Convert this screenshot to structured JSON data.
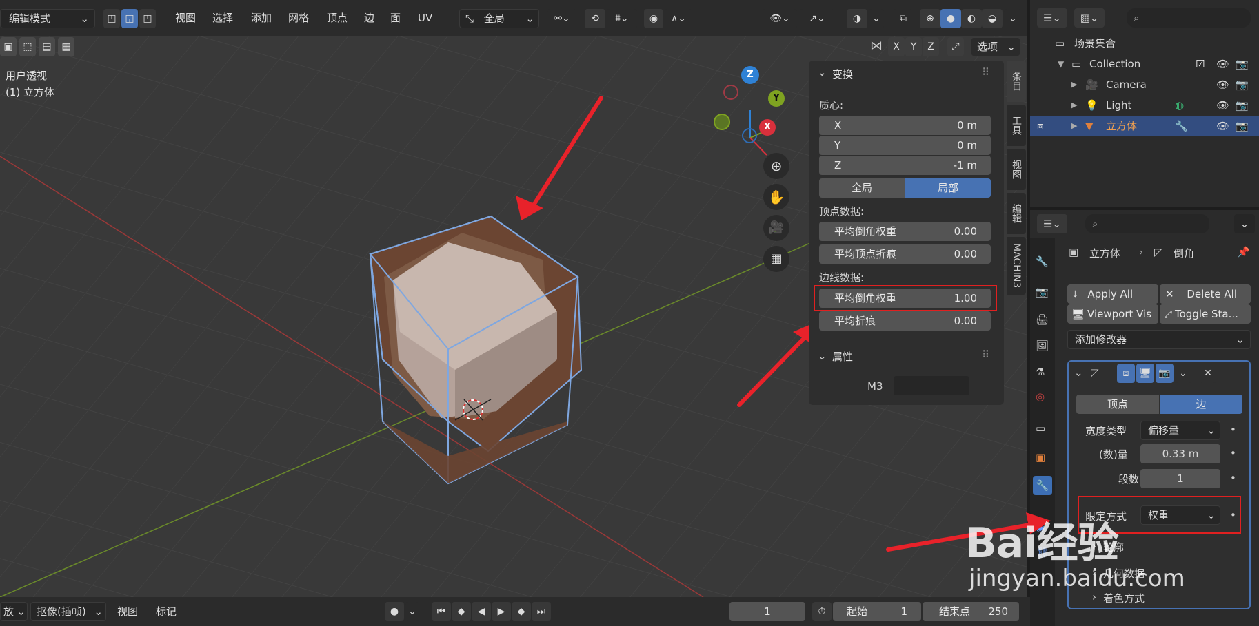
{
  "header": {
    "mode": "编辑模式",
    "menu": [
      "视图",
      "选择",
      "添加",
      "网格",
      "顶点",
      "边",
      "面",
      "UV"
    ],
    "orientation": "全局",
    "options_label": "选项",
    "axes": [
      "X",
      "Y",
      "Z"
    ]
  },
  "viewport": {
    "view_label": "用户透视",
    "object_label": "(1) 立方体",
    "gizmo": {
      "z": "Z",
      "y": "Y",
      "x": "X"
    }
  },
  "npanel": {
    "transform_title": "变换",
    "centroid_label": "质心:",
    "centroid": [
      {
        "axis": "X",
        "value": "0 m"
      },
      {
        "axis": "Y",
        "value": "0 m"
      },
      {
        "axis": "Z",
        "value": "-1 m"
      }
    ],
    "space_global": "全局",
    "space_local": "局部",
    "vertex_data_label": "顶点数据:",
    "vertex_data": [
      {
        "label": "平均倒角权重",
        "value": "0.00"
      },
      {
        "label": "平均顶点折痕",
        "value": "0.00"
      }
    ],
    "edge_data_label": "边线数据:",
    "edge_data": [
      {
        "label": "平均倒角权重",
        "value": "1.00"
      },
      {
        "label": "平均折痕",
        "value": "0.00"
      }
    ],
    "attributes_title": "属性",
    "attr_label": "M3",
    "tabs": [
      "条目",
      "工具",
      "视图",
      "编辑",
      "MACHIN3"
    ]
  },
  "outliner": {
    "scene_collection": "场景集合",
    "items": [
      {
        "name": "Collection",
        "type": "collection"
      },
      {
        "name": "Camera",
        "type": "camera"
      },
      {
        "name": "Light",
        "type": "light"
      },
      {
        "name": "立方体",
        "type": "mesh"
      }
    ]
  },
  "properties": {
    "breadcrumb_object": "立方体",
    "breadcrumb_modifier": "倒角",
    "apply_all": "Apply All",
    "delete_all": "Delete All",
    "viewport_vis": "Viewport Vis",
    "toggle_stack": "Toggle Sta...",
    "add_modifier": "添加修改器",
    "affect_vertex": "顶点",
    "affect_edge": "边",
    "width_type_label": "宽度类型",
    "width_type_value": "偏移量",
    "amount_label": "(数)量",
    "amount_value": "0.33 m",
    "segments_label": "段数",
    "segments_value": "1",
    "limit_method_label": "限定方式",
    "limit_method_value": "权重",
    "sub_profile": "轮廓",
    "sub_geometry": "几何数据",
    "sub_shading": "着色方式"
  },
  "timeline": {
    "playback": "放",
    "keying": "抠像(插帧)",
    "view": "视图",
    "marker": "标记",
    "current_frame": "1",
    "start_label": "起始",
    "start_value": "1",
    "end_label": "结束点",
    "end_value": "250"
  },
  "watermark": {
    "brand": "Bai经验",
    "url": "jingyan.baidu.com"
  },
  "colors": {
    "accent": "#4772b3",
    "highlight_box": "#e02020",
    "arrow": "#e8222a",
    "grid_x": "#9a3838",
    "grid_y": "#6a8a2a"
  }
}
